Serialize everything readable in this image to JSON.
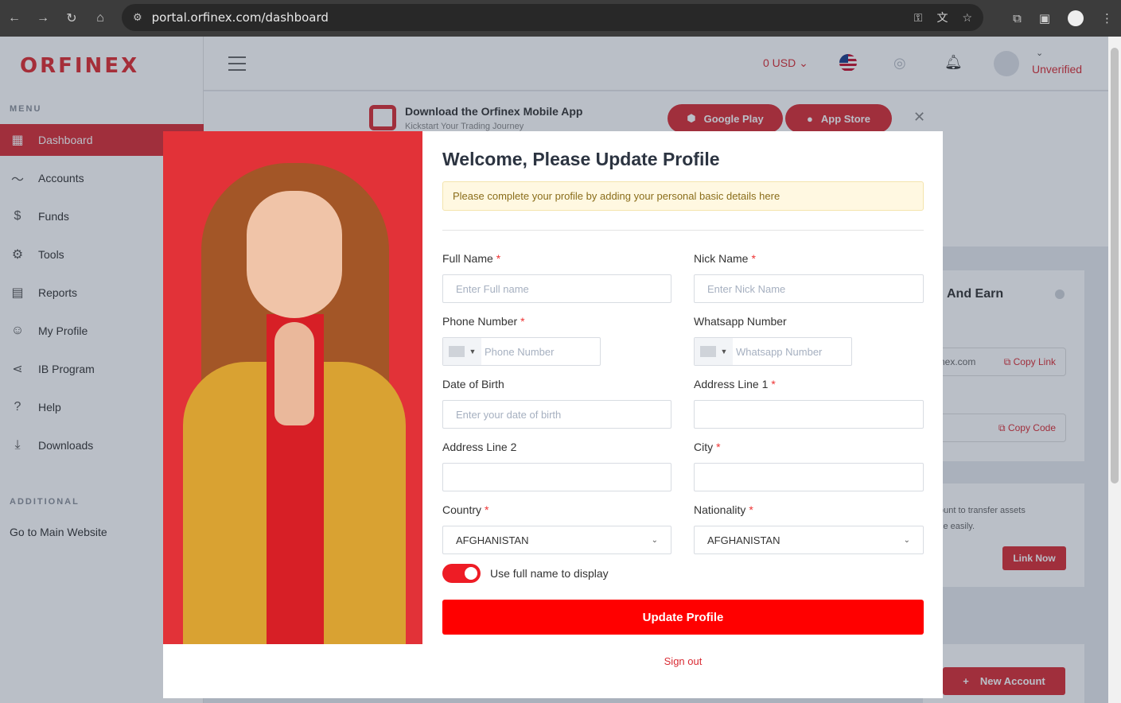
{
  "browser": {
    "url": "portal.orfinex.com/dashboard"
  },
  "sidebar": {
    "logo": "ORFINEX",
    "menu_title": "MENU",
    "items": [
      {
        "label": "Dashboard",
        "icon": "grid-icon"
      },
      {
        "label": "Accounts",
        "icon": "pulse-icon"
      },
      {
        "label": "Funds",
        "icon": "funds-icon"
      },
      {
        "label": "Tools",
        "icon": "gear-icon"
      },
      {
        "label": "Reports",
        "icon": "report-icon"
      },
      {
        "label": "My Profile",
        "icon": "user-icon"
      },
      {
        "label": "IB Program",
        "icon": "share-icon"
      },
      {
        "label": "Help",
        "icon": "help-icon"
      },
      {
        "label": "Downloads",
        "icon": "download-icon"
      }
    ],
    "additional_title": "ADDITIONAL",
    "main_website": "Go to Main Website"
  },
  "topbar": {
    "currency": "0 USD",
    "status": "Unverified"
  },
  "banner": {
    "title": "Download the Orfinex Mobile App",
    "subtitle": "Kickstart Your Trading Journey",
    "google_play": "Google Play",
    "app_store": "App Store"
  },
  "background_cards": {
    "refer_title": "And Earn",
    "link_prefix": "finex.com",
    "copy_link": "Copy Link",
    "copy_code": "Copy Code",
    "link_text_1": "ount to transfer assets",
    "link_text_2": "ce easily.",
    "link_now": "Link Now",
    "new_account": "New Account"
  },
  "modal": {
    "title": "Welcome, Please Update Profile",
    "note": "Please complete your profile by adding your personal basic details here",
    "fields": {
      "full_name": {
        "label": "Full Name",
        "placeholder": "Enter Full name",
        "value": ""
      },
      "nick_name": {
        "label": "Nick Name",
        "placeholder": "Enter Nick Name",
        "value": ""
      },
      "phone": {
        "label": "Phone Number",
        "placeholder": "Phone Number"
      },
      "whatsapp": {
        "label": "Whatsapp Number",
        "placeholder": "Whatsapp Number"
      },
      "dob": {
        "label": "Date of Birth",
        "placeholder": "Enter your date of birth"
      },
      "address1": {
        "label": "Address Line 1",
        "value": ""
      },
      "address2": {
        "label": "Address Line 2",
        "value": ""
      },
      "city": {
        "label": "City",
        "value": ""
      },
      "country": {
        "label": "Country",
        "value": "AFGHANISTAN"
      },
      "nationality": {
        "label": "Nationality",
        "value": "AFGHANISTAN"
      }
    },
    "toggle_label": "Use full name to display",
    "toggle_on": true,
    "submit": "Update Profile",
    "signout": "Sign out"
  },
  "colors": {
    "brand_red": "#d92b33",
    "button_red": "#ff0000"
  }
}
